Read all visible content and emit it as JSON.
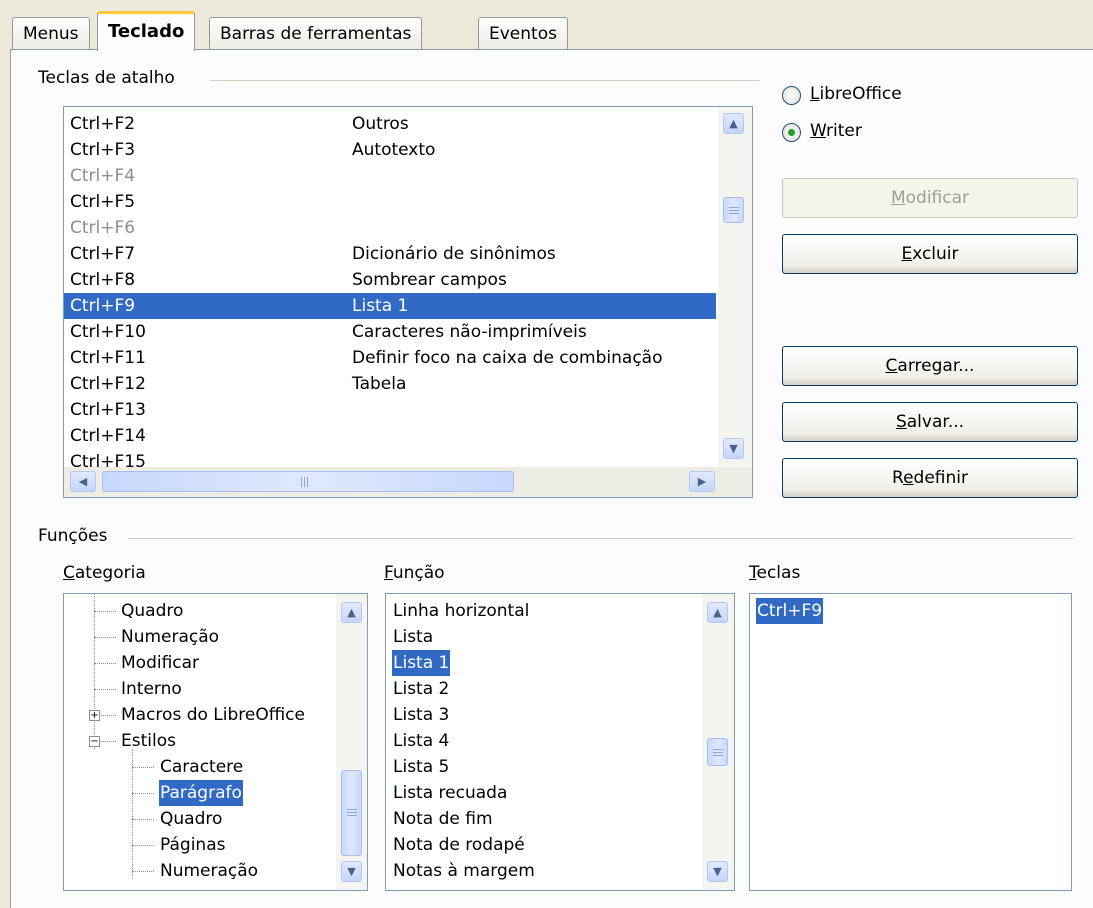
{
  "tabs": [
    {
      "label": "Menus"
    },
    {
      "label": "Teclado"
    },
    {
      "label": "Barras de ferramentas"
    },
    {
      "label": "Eventos"
    }
  ],
  "shortcuts": {
    "label": "Teclas de atalho",
    "rows": [
      {
        "key": "Ctrl+F2",
        "command": "Outros"
      },
      {
        "key": "Ctrl+F3",
        "command": "Autotexto"
      },
      {
        "key": "Ctrl+F4",
        "command": ""
      },
      {
        "key": "Ctrl+F5",
        "command": ""
      },
      {
        "key": "Ctrl+F6",
        "command": ""
      },
      {
        "key": "Ctrl+F7",
        "command": "Dicionário de sinônimos"
      },
      {
        "key": "Ctrl+F8",
        "command": "Sombrear campos"
      },
      {
        "key": "Ctrl+F9",
        "command": "Lista 1"
      },
      {
        "key": "Ctrl+F10",
        "command": "Caracteres não-imprimíveis"
      },
      {
        "key": "Ctrl+F11",
        "command": "Definir foco na caixa de combinação"
      },
      {
        "key": "Ctrl+F12",
        "command": "Tabela"
      },
      {
        "key": "Ctrl+F13",
        "command": ""
      },
      {
        "key": "Ctrl+F14",
        "command": ""
      },
      {
        "key": "Ctrl+F15",
        "command": ""
      }
    ]
  },
  "scope": {
    "options": [
      {
        "label": "LibreOffice",
        "accel": "L",
        "rest": "ibreOffice"
      },
      {
        "label": "Writer",
        "accel": "W",
        "rest": "riter"
      }
    ],
    "selected": "Writer"
  },
  "buttons": {
    "modify": {
      "accel": "M",
      "rest": "odificar"
    },
    "delete": {
      "accel": "E",
      "rest": "xcluir"
    },
    "load": {
      "accel": "C",
      "rest": "arregar..."
    },
    "save": {
      "accel": "S",
      "rest": "alvar..."
    },
    "reset": {
      "pre": "R",
      "accel": "e",
      "rest": "definir"
    }
  },
  "functions": {
    "label": "Funções",
    "category_label": {
      "accel": "C",
      "rest": "ategoria"
    },
    "function_label": {
      "accel": "F",
      "rest": "unção"
    },
    "keys_label": {
      "accel": "T",
      "rest": "eclas"
    },
    "categories": [
      {
        "label": "Quadro",
        "level": 1
      },
      {
        "label": "Numeração",
        "level": 1
      },
      {
        "label": "Modificar",
        "level": 1
      },
      {
        "label": "Interno",
        "level": 1
      },
      {
        "label": "Macros do LibreOffice",
        "level": 1,
        "expander": "+"
      },
      {
        "label": "Estilos",
        "level": 1,
        "expander": "−"
      },
      {
        "label": "Caractere",
        "level": 2
      },
      {
        "label": "Parágrafo",
        "level": 2,
        "selected": true
      },
      {
        "label": "Quadro",
        "level": 2
      },
      {
        "label": "Páginas",
        "level": 2
      },
      {
        "label": "Numeração",
        "level": 2
      }
    ],
    "functions_list": [
      "Linha horizontal",
      "Lista",
      "Lista 1",
      "Lista 2",
      "Lista 3",
      "Lista 4",
      "Lista 5",
      "Lista recuada",
      "Nota de fim",
      "Nota de rodapé",
      "Notas à margem"
    ],
    "selected_function": "Lista 1",
    "keys": [
      "Ctrl+F9"
    ]
  }
}
